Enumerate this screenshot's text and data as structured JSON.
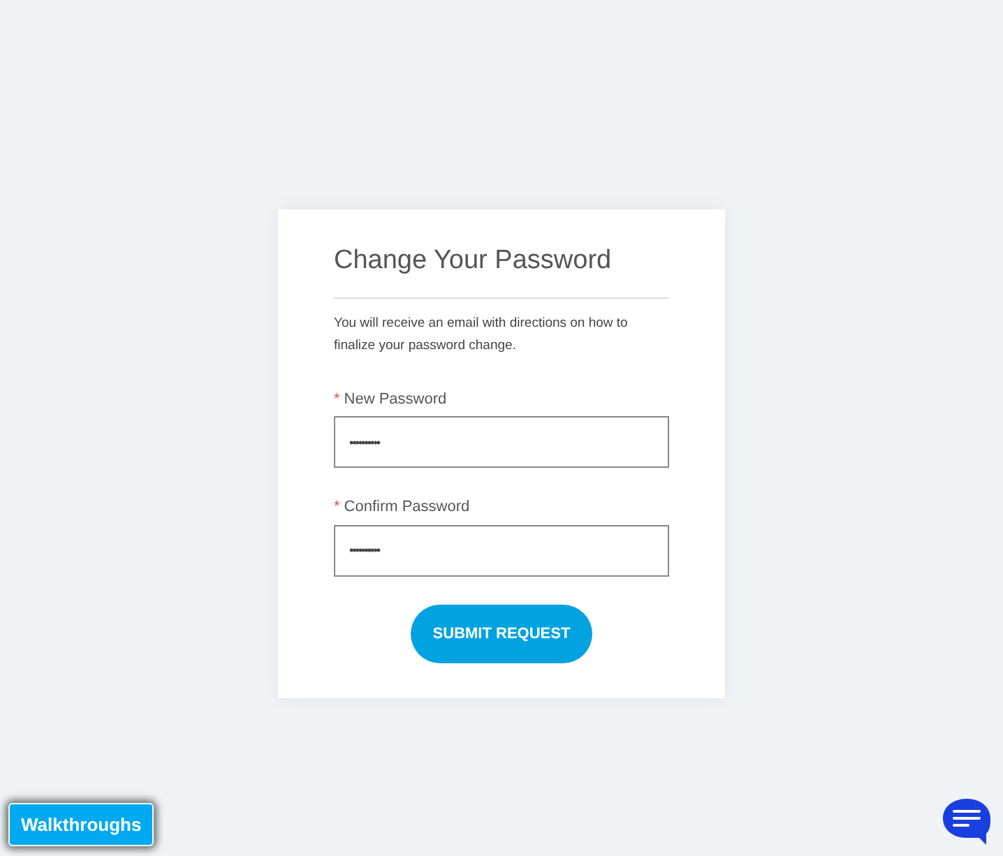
{
  "form": {
    "title": "Change Your Password",
    "description": "You will receive an email with directions on how to finalize your password change.",
    "fields": [
      {
        "required_mark": "*",
        "label": "New Password",
        "value": "••••••••••"
      },
      {
        "required_mark": "*",
        "label": "Confirm Password",
        "value": "••••••••••"
      }
    ],
    "submit": "SUBMIT REQUEST"
  },
  "walkthroughs_button": "Walkthroughs"
}
